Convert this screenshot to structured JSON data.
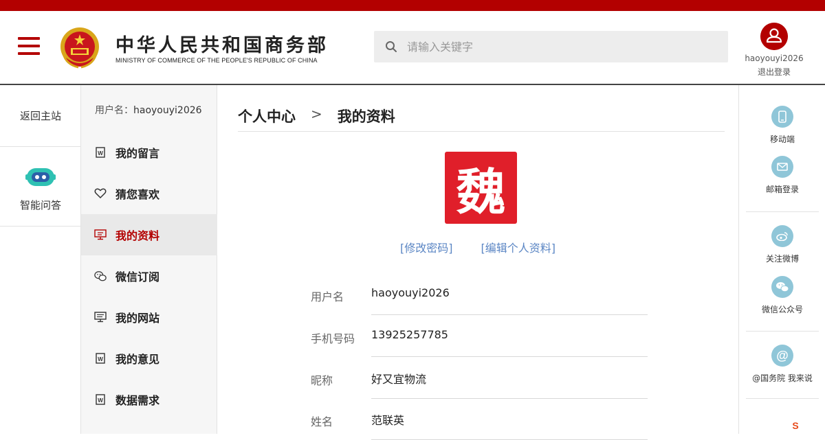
{
  "header": {
    "logo_cn": "中华人民共和国商务部",
    "logo_en": "MINISTRY OF COMMERCE OF THE PEOPLE'S REPUBLIC OF CHINA",
    "search_placeholder": "请输入关键字",
    "username": "haoyouyi2026",
    "logout": "退出登录",
    "accent": "#b30000"
  },
  "left": {
    "back_home": "返回主站",
    "qa_label": "智能问答"
  },
  "nav": {
    "user_prefix": "用户名：",
    "user_value": "haoyouyi2026",
    "items": [
      {
        "label": "我的留言",
        "icon": "word-doc-icon"
      },
      {
        "label": "猜您喜欢",
        "icon": "heart-icon"
      },
      {
        "label": "我的资料",
        "icon": "monitor-profile-icon"
      },
      {
        "label": "微信订阅",
        "icon": "wechat-icon"
      },
      {
        "label": "我的网站",
        "icon": "monitor-icon"
      },
      {
        "label": "我的意见",
        "icon": "word-doc-icon"
      },
      {
        "label": "数据需求",
        "icon": "word-doc-icon"
      }
    ],
    "active_index": 2
  },
  "main": {
    "breadcrumb_root": "个人中心",
    "breadcrumb_sep": ">",
    "breadcrumb_current": "我的资料",
    "avatar_char": "魏",
    "change_password": "[修改密码]",
    "edit_profile": "[编辑个人资料]",
    "fields": [
      {
        "label": "用户名",
        "value": "haoyouyi2026"
      },
      {
        "label": "手机号码",
        "value": "13925257785"
      },
      {
        "label": "昵称",
        "value": "好又宜物流"
      },
      {
        "label": "姓名",
        "value": "范联英"
      }
    ]
  },
  "right": {
    "items": [
      {
        "label": "移动端",
        "icon": "mobile-icon"
      },
      {
        "label": "邮箱登录",
        "icon": "mail-icon"
      },
      {
        "label": "关注微博",
        "icon": "weibo-icon"
      },
      {
        "label": "微信公众号",
        "icon": "wechat-icon"
      },
      {
        "label": "@国务院 我来说",
        "icon": "at-icon"
      }
    ]
  }
}
